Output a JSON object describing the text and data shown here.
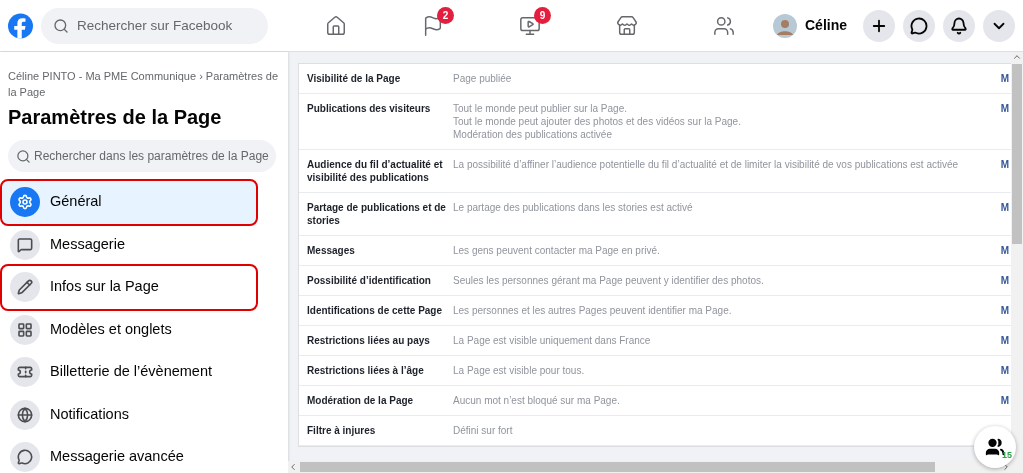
{
  "topbar": {
    "search": {
      "placeholder": "Rechercher sur Facebook"
    },
    "nav": [
      {
        "kind": "home"
      },
      {
        "kind": "flag",
        "badge": "2"
      },
      {
        "kind": "video",
        "badge": "9"
      },
      {
        "kind": "store"
      },
      {
        "kind": "groups"
      }
    ],
    "user": {
      "name": "Céline"
    },
    "actions": [
      {
        "kind": "plus"
      },
      {
        "kind": "messenger"
      },
      {
        "kind": "bell"
      },
      {
        "kind": "caret"
      }
    ]
  },
  "sidebar": {
    "breadcrumb": "Céline PINTO - Ma PME Communique › Paramètres de la Page",
    "title": "Paramètres de la Page",
    "search": {
      "placeholder": "Rechercher dans les paramètres de la Page"
    },
    "items": [
      {
        "label": "Général",
        "selected": true,
        "highlighted": true
      },
      {
        "label": "Messagerie",
        "selected": false,
        "highlighted": false
      },
      {
        "label": "Infos sur la Page",
        "selected": false,
        "highlighted": true
      },
      {
        "label": "Modèles et onglets",
        "selected": false,
        "highlighted": false
      },
      {
        "label": "Billetterie de l’évènement",
        "selected": false,
        "highlighted": false
      },
      {
        "label": "Notifications",
        "selected": false,
        "highlighted": false
      },
      {
        "label": "Messagerie avancée",
        "selected": false,
        "highlighted": false
      }
    ]
  },
  "settings": [
    {
      "label": "Visibilité de la Page",
      "lines": [
        "Page publiée"
      ],
      "edit": "M"
    },
    {
      "label": "Publications des visiteurs",
      "lines": [
        "Tout le monde peut publier sur la Page.",
        "Tout le monde peut ajouter des photos et des vidéos sur la Page.",
        "Modération des publications activée"
      ],
      "edit": "M"
    },
    {
      "label": "Audience du fil d’actualité et visibilité des publications",
      "lines": [
        "La possibilité d’affiner l’audience potentielle du fil d’actualité et de limiter la visibilité de vos publications est activée"
      ],
      "edit": "M"
    },
    {
      "label": "Partage de publications et de stories",
      "lines": [
        "Le partage des publications dans les stories est activé"
      ],
      "edit": "M"
    },
    {
      "label": "Messages",
      "lines": [
        "Les gens peuvent contacter ma Page en privé."
      ],
      "edit": "M"
    },
    {
      "label": "Possibilité d’identification",
      "lines": [
        "Seules les personnes gérant ma Page peuvent y identifier des photos."
      ],
      "edit": "M"
    },
    {
      "label": "Identifications de cette Page",
      "lines": [
        "Les personnes et les autres Pages peuvent identifier ma Page."
      ],
      "edit": "M"
    },
    {
      "label": "Restrictions liées au pays",
      "lines": [
        "La Page est visible uniquement dans France"
      ],
      "edit": "M"
    },
    {
      "label": "Restrictions liées à l’âge",
      "lines": [
        "La Page est visible pour tous."
      ],
      "edit": "M"
    },
    {
      "label": "Modération de la Page",
      "lines": [
        "Aucun mot n’est bloqué sur ma Page."
      ],
      "edit": "M"
    },
    {
      "label": "Filtre à injures",
      "lines": [
        "Défini sur fort"
      ]
    }
  ],
  "contacts_button": {
    "count": "15"
  }
}
